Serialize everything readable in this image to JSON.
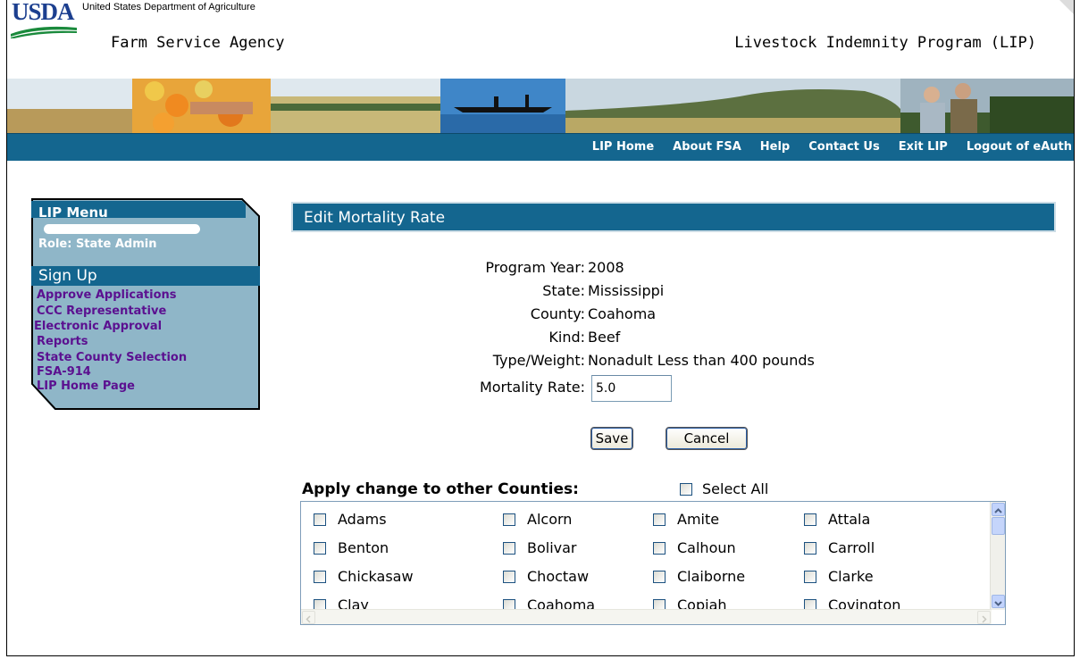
{
  "header": {
    "logo_text": "USDA",
    "department": "United States Department of Agriculture",
    "agency": "Farm Service Agency",
    "program_title": "Livestock Indemnity Program (LIP)"
  },
  "nav": {
    "items": [
      "LIP Home",
      "About FSA",
      "Help",
      "Contact Us",
      "Exit LIP",
      "Logout of eAuth"
    ]
  },
  "sidebar": {
    "title": "LIP Menu",
    "role": "Role: State Admin",
    "section": "Sign Up",
    "links": [
      "Approve Applications",
      "CCC Representative",
      "Electronic Approval",
      "Reports",
      "State County Selection",
      "FSA-914",
      "LIP Home Page"
    ]
  },
  "main": {
    "title": "Edit Mortality Rate",
    "fields": [
      {
        "label": "Program Year:",
        "value": "2008"
      },
      {
        "label": "State:",
        "value": "Mississippi"
      },
      {
        "label": "County:",
        "value": "Coahoma"
      },
      {
        "label": "Kind:",
        "value": "Beef"
      },
      {
        "label": "Type/Weight:",
        "value": "Nonadult Less than 400 pounds"
      }
    ],
    "mortality_label": "Mortality Rate:",
    "mortality_value": "5.0",
    "save_label": "Save",
    "cancel_label": "Cancel",
    "apply_label": "Apply change to other Counties:",
    "select_all_label": "Select All",
    "counties": [
      [
        "Adams",
        "Alcorn",
        "Amite",
        "Attala"
      ],
      [
        "Benton",
        "Bolivar",
        "Calhoun",
        "Carroll"
      ],
      [
        "Chickasaw",
        "Choctaw",
        "Claiborne",
        "Clarke"
      ],
      [
        "Clay",
        "Coahoma",
        "Copiah",
        "Covington"
      ]
    ]
  },
  "colors": {
    "nav_blue": "#14668f",
    "menu_bg": "#8fb6c8",
    "link_purple": "#5b1090",
    "usda_blue": "#1c3f8f"
  }
}
